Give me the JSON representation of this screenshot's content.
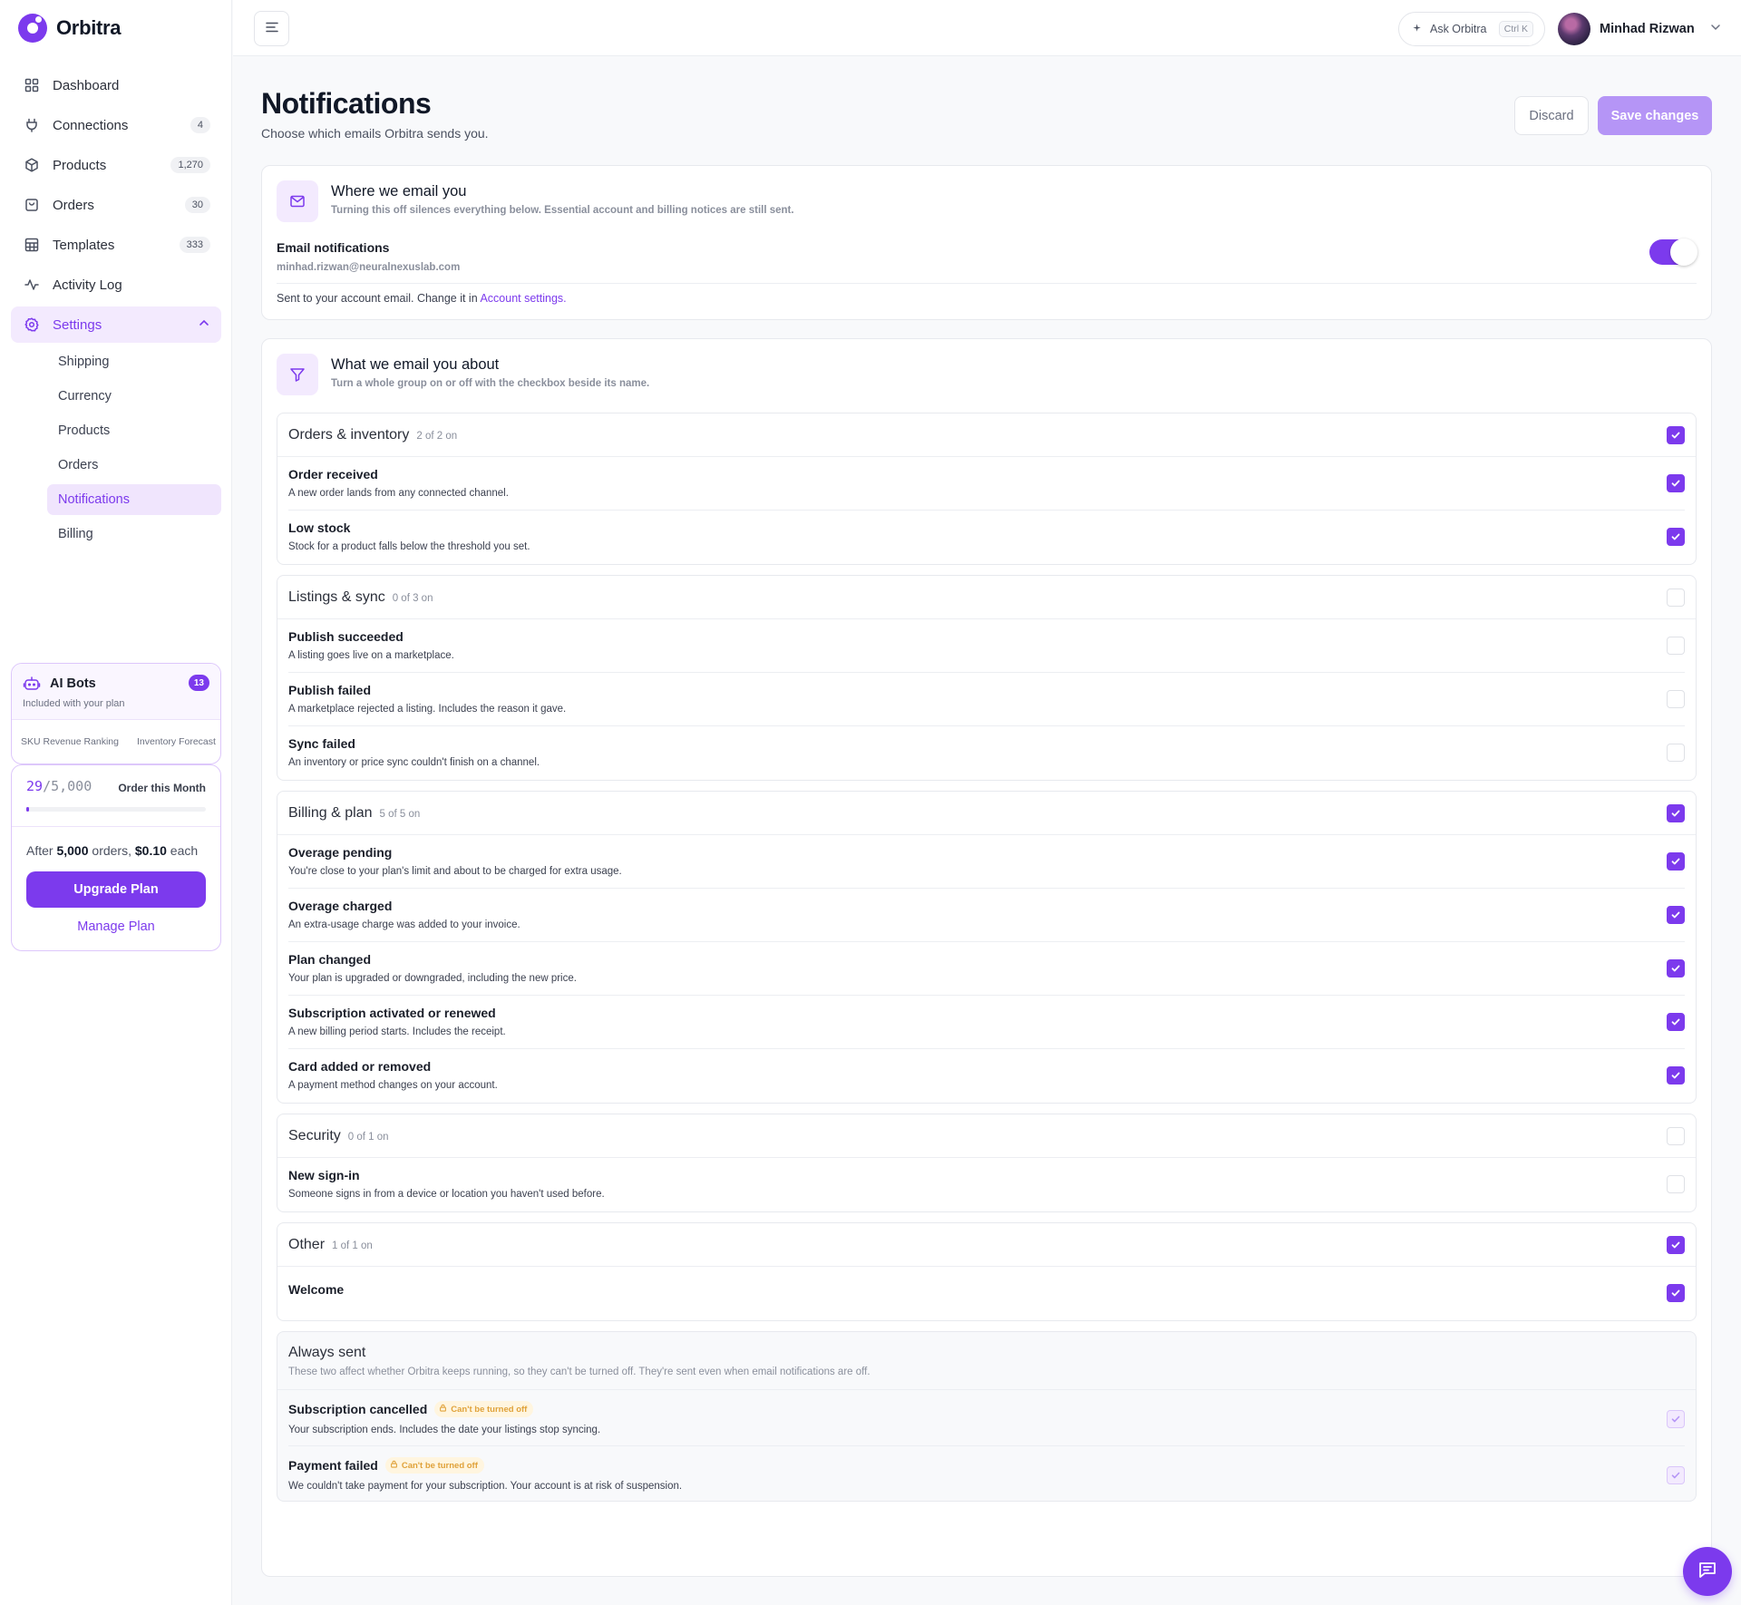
{
  "app": {
    "name": "Orbitra"
  },
  "sidebar": {
    "items": [
      {
        "label": "Dashboard",
        "icon": "dashboard-icon"
      },
      {
        "label": "Connections",
        "count": "4",
        "icon": "plug-icon"
      },
      {
        "label": "Products",
        "count": "1,270",
        "icon": "box-icon"
      },
      {
        "label": "Orders",
        "count": "30",
        "icon": "bag-icon"
      },
      {
        "label": "Templates",
        "count": "333",
        "icon": "table-icon"
      },
      {
        "label": "Activity Log",
        "icon": "activity-icon"
      },
      {
        "label": "Settings",
        "icon": "gear-icon",
        "active": true
      }
    ],
    "settings_sub": [
      {
        "label": "Shipping"
      },
      {
        "label": "Currency"
      },
      {
        "label": "Products"
      },
      {
        "label": "Orders"
      },
      {
        "label": "Notifications",
        "active": true
      },
      {
        "label": "Billing"
      }
    ],
    "bots": {
      "title": "AI Bots",
      "count": "13",
      "subtitle": "Included with your plan",
      "list": [
        "SKU Revenue Ranking",
        "Inventory Forecast"
      ]
    },
    "plan": {
      "used": "29",
      "limit": "/5,000",
      "label": "Order this Month",
      "usage_fraction": 0.0058,
      "after_prefix": "After ",
      "after_orders": "5,000",
      "after_mid": " orders, ",
      "after_price": "$0.10",
      "after_suffix": " each",
      "upgrade_label": "Upgrade Plan",
      "manage_label": "Manage Plan"
    }
  },
  "topbar": {
    "ask_label": "Ask Orbitra",
    "ask_shortcut": "Ctrl K",
    "user_name": "Minhad Rizwan"
  },
  "page": {
    "title": "Notifications",
    "subtitle": "Choose which emails Orbitra sends you.",
    "discard_label": "Discard",
    "save_label": "Save changes"
  },
  "where": {
    "title": "Where we email you",
    "desc": "Turning this off silences everything below. Essential account and billing notices are still sent.",
    "label": "Email notifications",
    "email": "minhad.rizwan@neuralnexuslab.com",
    "enabled": true,
    "note_prefix": "Sent to your account email. Change it in ",
    "note_link": "Account settings."
  },
  "what": {
    "title": "What we email you about",
    "desc": "Turn a whole group on or off with the checkbox beside its name."
  },
  "groups": [
    {
      "name": "Orders & inventory",
      "count": "2 of 2 on",
      "checked": true,
      "items": [
        {
          "title": "Order received",
          "desc": "A new order lands from any connected channel.",
          "checked": true
        },
        {
          "title": "Low stock",
          "desc": "Stock for a product falls below the threshold you set.",
          "checked": true
        }
      ]
    },
    {
      "name": "Listings & sync",
      "count": "0 of 3 on",
      "checked": false,
      "items": [
        {
          "title": "Publish succeeded",
          "desc": "A listing goes live on a marketplace.",
          "checked": false
        },
        {
          "title": "Publish failed",
          "desc": "A marketplace rejected a listing. Includes the reason it gave.",
          "checked": false
        },
        {
          "title": "Sync failed",
          "desc": "An inventory or price sync couldn't finish on a channel.",
          "checked": false
        }
      ]
    },
    {
      "name": "Billing & plan",
      "count": "5 of 5 on",
      "checked": true,
      "items": [
        {
          "title": "Overage pending",
          "desc": "You're close to your plan's limit and about to be charged for extra usage.",
          "checked": true
        },
        {
          "title": "Overage charged",
          "desc": "An extra-usage charge was added to your invoice.",
          "checked": true
        },
        {
          "title": "Plan changed",
          "desc": "Your plan is upgraded or downgraded, including the new price.",
          "checked": true
        },
        {
          "title": "Subscription activated or renewed",
          "desc": "A new billing period starts. Includes the receipt.",
          "checked": true
        },
        {
          "title": "Card added or removed",
          "desc": "A payment method changes on your account.",
          "checked": true
        }
      ]
    },
    {
      "name": "Security",
      "count": "0 of 1 on",
      "checked": false,
      "items": [
        {
          "title": "New sign-in",
          "desc": "Someone signs in from a device or location you haven't used before.",
          "checked": false
        }
      ]
    },
    {
      "name": "Other",
      "count": "1 of 1 on",
      "checked": true,
      "items": [
        {
          "title": "Welcome",
          "desc": "",
          "checked": true
        }
      ]
    }
  ],
  "always": {
    "name": "Always sent",
    "desc": "These two affect whether Orbitra keeps running, so they can't be turned off. They're sent even when email notifications are off.",
    "badge": "Can't be turned off",
    "items": [
      {
        "title": "Subscription cancelled",
        "desc": "Your subscription ends. Includes the date your listings stop syncing."
      },
      {
        "title": "Payment failed",
        "desc": "We couldn't take payment for your subscription. Your account is at risk of suspension."
      }
    ]
  },
  "colors": {
    "accent": "#7c3aed",
    "accent_soft": "#f3eafe",
    "save_disabled": "#b595f6",
    "lock_badge": "#e0a23a"
  }
}
